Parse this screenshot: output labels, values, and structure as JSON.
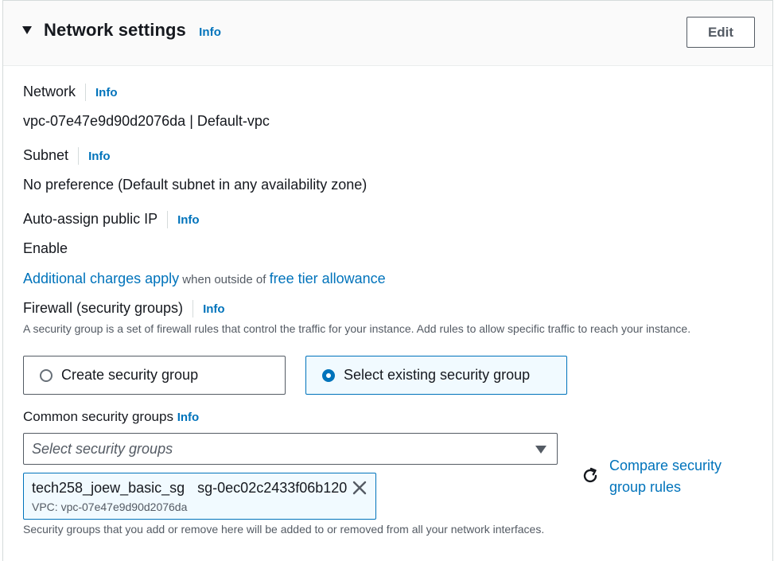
{
  "header": {
    "title": "Network settings",
    "info": "Info",
    "edit_button": "Edit"
  },
  "network": {
    "label": "Network",
    "info": "Info",
    "value": "vpc-07e47e9d90d2076da | Default-vpc"
  },
  "subnet": {
    "label": "Subnet",
    "info": "Info",
    "value": "No preference (Default subnet in any availability zone)"
  },
  "auto_assign_ip": {
    "label": "Auto-assign public IP",
    "info": "Info",
    "value": "Enable"
  },
  "charges": {
    "link1": "Additional charges apply",
    "middle": " when outside of ",
    "link2": "free tier allowance"
  },
  "firewall": {
    "label": "Firewall (security groups)",
    "info": "Info",
    "description": "A security group is a set of firewall rules that control the traffic for your instance. Add rules to allow specific traffic to reach your instance.",
    "options": [
      {
        "label": "Create security group",
        "selected": false
      },
      {
        "label": "Select existing security group",
        "selected": true
      }
    ]
  },
  "common_sg": {
    "label": "Common security groups",
    "info": "Info",
    "placeholder": "Select security groups",
    "selected": {
      "name": "tech258_joew_basic_sg",
      "id": "sg-0ec02c2433f06b120",
      "vpc": "VPC: vpc-07e47e9d90d2076da"
    },
    "compare_line1": "Compare security",
    "compare_line2": "group rules",
    "footer_note": "Security groups that you add or remove here will be added to or removed from all your network interfaces."
  },
  "colors": {
    "link": "#0073bb",
    "text": "#16191f",
    "secondary_text": "#545b64",
    "selected_bg": "#f1faff"
  },
  "icons": [
    "caret-down-icon",
    "radio-icon",
    "dropdown-arrow-icon",
    "close-icon",
    "refresh-icon"
  ]
}
